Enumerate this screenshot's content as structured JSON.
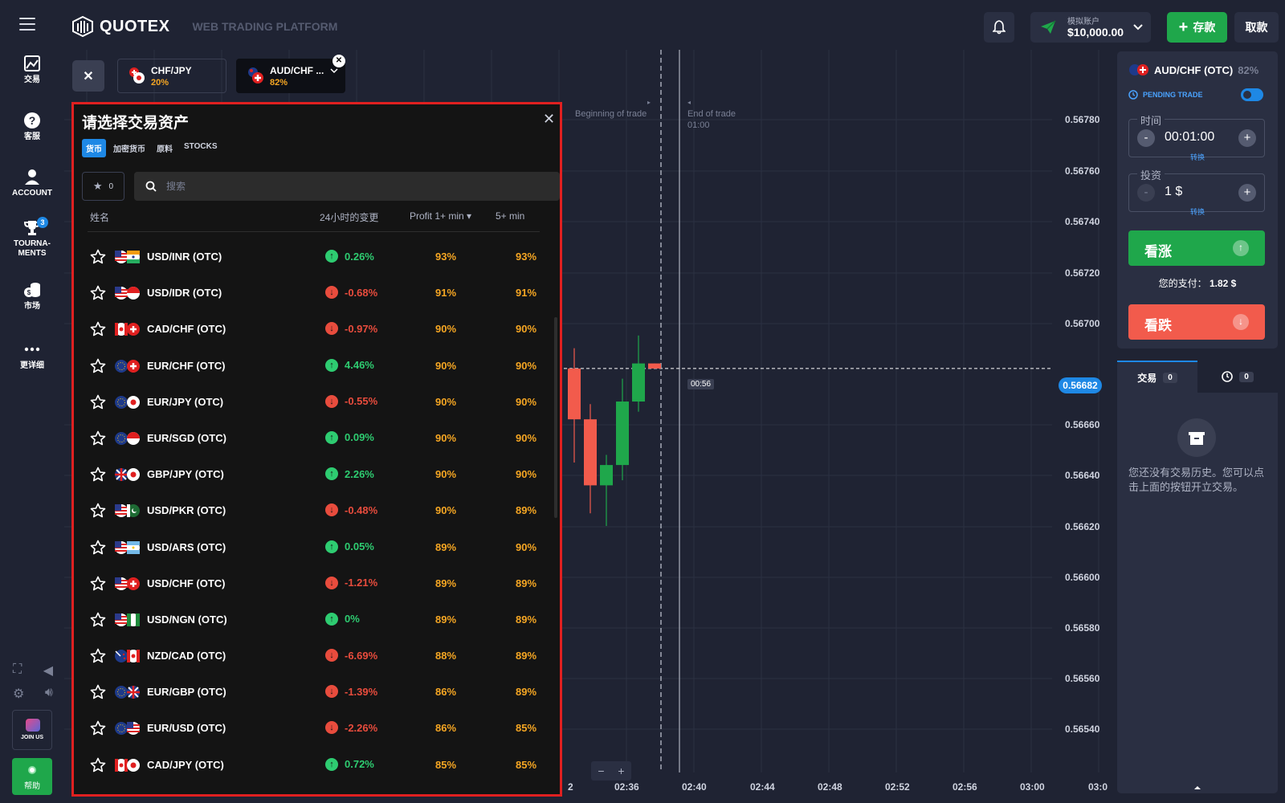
{
  "header": {
    "brand": "QUOTEX",
    "subtitle": "WEB TRADING PLATFORM",
    "account_label": "模拟账户",
    "balance": "$10,000.00",
    "deposit": "存款",
    "withdraw": "取款"
  },
  "sidebar": {
    "trade": "交易",
    "support": "客服",
    "account": "ACCOUNT",
    "tournaments_line1": "TOURNA-",
    "tournaments_line2": "MENTS",
    "tournaments_badge": "3",
    "market": "市场",
    "more": "更详细",
    "join_us": "JOIN US",
    "help": "帮助"
  },
  "asset_tabs": [
    {
      "pair": "CHF/JPY",
      "payout": "20%"
    },
    {
      "pair": "AUD/CHF ...",
      "payout": "82%"
    }
  ],
  "chart": {
    "beginning_label": "Beginning of trade",
    "end_label": "End of trade",
    "end_time": "01:00",
    "timer": "00:56",
    "current_price": "0.56682",
    "price_ticks": [
      "0.56780",
      "0.56760",
      "0.56740",
      "0.56720",
      "0.56700",
      "0.56660",
      "0.56640",
      "0.56620",
      "0.56600",
      "0.56580",
      "0.56560",
      "0.56540"
    ],
    "time_ticks": [
      "2",
      "02:36",
      "02:40",
      "02:44",
      "02:48",
      "02:52",
      "02:56",
      "03:00",
      "03:0"
    ],
    "zoom_minus": "−",
    "zoom_plus": "+"
  },
  "trade_panel": {
    "asset": "AUD/CHF (OTC)",
    "asset_payout": "82%",
    "pending": "PENDING TRADE",
    "time_label": "时间",
    "time_value": "00:01:00",
    "time_switch": "转换",
    "invest_label": "投资",
    "invest_value": "1 $",
    "invest_switch": "转换",
    "up": "看涨",
    "payout_label": "您的支付：",
    "payout_value": "1.82 $",
    "down": "看跌"
  },
  "history_panel": {
    "trades_tab": "交易",
    "trades_count": "0",
    "pending_count": "0",
    "empty_text": "您还没有交易历史。您可以点击上面的按钮开立交易。"
  },
  "picker": {
    "title": "请选择交易资产",
    "categories": [
      "货币",
      "加密货币",
      "原料",
      "STOCKS"
    ],
    "fav_count": "0",
    "search_placeholder": "搜索",
    "columns": {
      "name": "姓名",
      "change": "24小时的变更",
      "profit1": "Profit 1+ min ▾",
      "profit5": "5+ min"
    },
    "assets": [
      {
        "name": "USD/INR (OTC)",
        "change": "0.26%",
        "up": true,
        "p1": "93%",
        "p5": "93%",
        "f1": "us",
        "f2": "in"
      },
      {
        "name": "USD/IDR (OTC)",
        "change": "-0.68%",
        "up": false,
        "p1": "91%",
        "p5": "91%",
        "f1": "us",
        "f2": "id"
      },
      {
        "name": "CAD/CHF (OTC)",
        "change": "-0.97%",
        "up": false,
        "p1": "90%",
        "p5": "90%",
        "f1": "ca",
        "f2": "ch"
      },
      {
        "name": "EUR/CHF (OTC)",
        "change": "4.46%",
        "up": true,
        "p1": "90%",
        "p5": "90%",
        "f1": "eu",
        "f2": "ch"
      },
      {
        "name": "EUR/JPY (OTC)",
        "change": "-0.55%",
        "up": false,
        "p1": "90%",
        "p5": "90%",
        "f1": "eu",
        "f2": "jp"
      },
      {
        "name": "EUR/SGD (OTC)",
        "change": "0.09%",
        "up": true,
        "p1": "90%",
        "p5": "90%",
        "f1": "eu",
        "f2": "sg"
      },
      {
        "name": "GBP/JPY (OTC)",
        "change": "2.26%",
        "up": true,
        "p1": "90%",
        "p5": "90%",
        "f1": "gb",
        "f2": "jp"
      },
      {
        "name": "USD/PKR (OTC)",
        "change": "-0.48%",
        "up": false,
        "p1": "90%",
        "p5": "89%",
        "f1": "us",
        "f2": "pk"
      },
      {
        "name": "USD/ARS (OTC)",
        "change": "0.05%",
        "up": true,
        "p1": "89%",
        "p5": "90%",
        "f1": "us",
        "f2": "ar"
      },
      {
        "name": "USD/CHF (OTC)",
        "change": "-1.21%",
        "up": false,
        "p1": "89%",
        "p5": "89%",
        "f1": "us",
        "f2": "ch"
      },
      {
        "name": "USD/NGN (OTC)",
        "change": "0%",
        "up": true,
        "p1": "89%",
        "p5": "89%",
        "f1": "us",
        "f2": "ng"
      },
      {
        "name": "NZD/CAD (OTC)",
        "change": "-6.69%",
        "up": false,
        "p1": "88%",
        "p5": "89%",
        "f1": "nz",
        "f2": "ca"
      },
      {
        "name": "EUR/GBP (OTC)",
        "change": "-1.39%",
        "up": false,
        "p1": "86%",
        "p5": "89%",
        "f1": "eu",
        "f2": "gb"
      },
      {
        "name": "EUR/USD (OTC)",
        "change": "-2.26%",
        "up": false,
        "p1": "86%",
        "p5": "85%",
        "f1": "eu",
        "f2": "us"
      },
      {
        "name": "CAD/JPY (OTC)",
        "change": "0.72%",
        "up": true,
        "p1": "85%",
        "p5": "85%",
        "f1": "ca",
        "f2": "jp"
      }
    ]
  },
  "colors": {
    "green": "#1fa74b",
    "red": "#f25b4c",
    "orange": "#f5a623",
    "blue": "#1e88e5",
    "up_change": "#2ecc71",
    "down_change": "#e84c3d"
  },
  "candles": [
    {
      "o": 0.56682,
      "h": 0.5669,
      "l": 0.56645,
      "c": 0.56662
    },
    {
      "o": 0.56662,
      "h": 0.56668,
      "l": 0.56625,
      "c": 0.56636
    },
    {
      "o": 0.56636,
      "h": 0.56648,
      "l": 0.5662,
      "c": 0.56644
    },
    {
      "o": 0.56644,
      "h": 0.56678,
      "l": 0.56638,
      "c": 0.56669
    },
    {
      "o": 0.56669,
      "h": 0.56695,
      "l": 0.56665,
      "c": 0.56684
    },
    {
      "o": 0.56684,
      "h": 0.56684,
      "l": 0.56682,
      "c": 0.56682
    }
  ]
}
